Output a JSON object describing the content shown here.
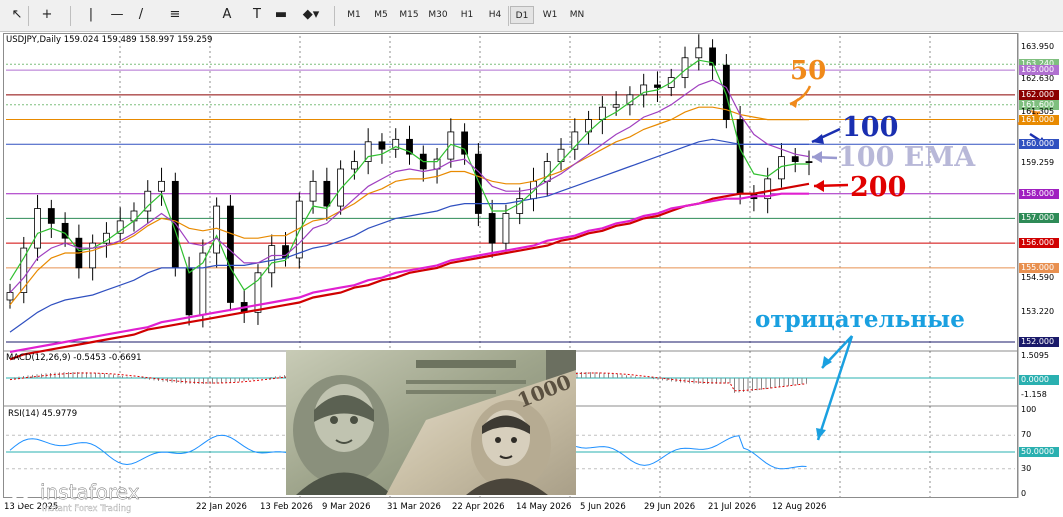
{
  "toolbar": {
    "tools": [
      "cursor-icon",
      "crosshair-icon",
      "vertical-line-icon",
      "horizontal-line-icon",
      "trendline-icon",
      "fibonacci-icon",
      "text-icon",
      "text-label-icon",
      "rectangle-icon",
      "shapes-menu-icon"
    ],
    "text_tool": "A",
    "timeframes": [
      "M1",
      "M5",
      "M15",
      "M30",
      "H1",
      "H4",
      "D1",
      "W1",
      "MN"
    ]
  },
  "chart_title": "USDJPY,Daily  159.024 159.489 158.997 159.259",
  "macd_title": "MACD(12,26,9) -0.5453 -0.6691",
  "rsi_title": "RSI(14) 45.9779",
  "annotations": {
    "ema50": "50",
    "ema100": "100",
    "ema100_label": "100 EMA",
    "ema200": "200",
    "negative": "отрицательные"
  },
  "price_labels": [
    {
      "value": "163.950",
      "bg": "none"
    },
    {
      "value": "163.240",
      "bg": "#7fbf7f"
    },
    {
      "value": "163.000",
      "bg": "#b070d0"
    },
    {
      "value": "162.630",
      "bg": "none"
    },
    {
      "value": "162.000",
      "bg": "#8b0000"
    },
    {
      "value": "161.600",
      "bg": "#7fbf7f"
    },
    {
      "value": "161.305",
      "bg": "none"
    },
    {
      "value": "161.000",
      "bg": "#e88a00"
    },
    {
      "value": "160.000",
      "bg": "#3050c0"
    },
    {
      "value": "159.259",
      "bg": "none"
    },
    {
      "value": "158.000",
      "bg": "#a020c0"
    },
    {
      "value": "157.000",
      "bg": "#2e8b57"
    },
    {
      "value": "156.000",
      "bg": "#d00000"
    },
    {
      "value": "155.000",
      "bg": "#e89050"
    },
    {
      "value": "154.590",
      "bg": "none"
    },
    {
      "value": "153.220",
      "bg": "none"
    },
    {
      "value": "152.000",
      "bg": "#1a1a6a"
    }
  ],
  "macd_labels": [
    {
      "value": "1.5095",
      "bg": "none"
    },
    {
      "value": "0.0000",
      "bg": "#2ab0b0"
    },
    {
      "value": "-1.158",
      "bg": "none"
    }
  ],
  "rsi_labels": [
    {
      "value": "100",
      "bg": "none"
    },
    {
      "value": "70",
      "bg": "none"
    },
    {
      "value": "50.0000",
      "bg": "#2ab0b0"
    },
    {
      "value": "30",
      "bg": "none"
    },
    {
      "value": "0",
      "bg": "none"
    }
  ],
  "logo": {
    "brand": "instaforex",
    "tagline": "Instant Forex Trading"
  },
  "photo": {
    "note_left": "dollar-banknote",
    "note_right": "yen-banknote",
    "yen_value": "1000"
  },
  "chart_data": {
    "type": "line",
    "title": "USDJPY,Daily",
    "ohlc_last": {
      "open": 159.024,
      "high": 159.489,
      "low": 158.997,
      "close": 159.259
    },
    "x_ticks": [
      "13 Dec 2025",
      "22 Jan 2026",
      "13 Feb 2026",
      "9 Mar 2026",
      "31 Mar 2026",
      "22 Apr 2026",
      "14 May 2026",
      "5 Jun 2026",
      "29 Jun 2026",
      "21 Jul 2026",
      "12 Aug 2026"
    ],
    "ylim": [
      152.0,
      164.3
    ],
    "y_ticks": [
      163.95,
      162.63,
      161.305,
      159.259,
      154.59,
      153.22
    ],
    "close_series": [
      154.0,
      155.8,
      157.4,
      156.8,
      156.2,
      155.0,
      156.0,
      156.4,
      156.9,
      157.3,
      158.1,
      158.5,
      155.0,
      153.1,
      155.6,
      157.5,
      153.6,
      153.2,
      154.8,
      155.9,
      155.4,
      157.7,
      158.5,
      157.5,
      159.0,
      159.3,
      160.1,
      159.8,
      160.2,
      159.6,
      159.0,
      159.4,
      160.5,
      159.6,
      157.2,
      156.0,
      157.2,
      157.8,
      158.5,
      159.3,
      159.8,
      160.5,
      161.0,
      161.5,
      161.6,
      162.0,
      162.4,
      162.3,
      162.7,
      163.5,
      163.9,
      163.2,
      161.0,
      158.0,
      157.8,
      158.6,
      159.5,
      159.3,
      159.26
    ],
    "series": [
      {
        "name": "EMA 50",
        "color": "#e88a00",
        "values": [
          153.5,
          154.2,
          154.9,
          155.4,
          155.6,
          155.6,
          155.7,
          155.9,
          156.0,
          156.3,
          156.7,
          157.0,
          156.9,
          156.6,
          156.5,
          156.6,
          156.4,
          156.2,
          156.2,
          156.3,
          156.3,
          156.6,
          156.9,
          157.0,
          157.3,
          157.6,
          158.0,
          158.2,
          158.5,
          158.6,
          158.6,
          158.7,
          158.9,
          158.9,
          158.7,
          158.5,
          158.4,
          158.4,
          158.5,
          158.7,
          158.9,
          159.2,
          159.5,
          159.8,
          160.1,
          160.3,
          160.6,
          160.8,
          161.0,
          161.3,
          161.5,
          161.5,
          161.4,
          161.2,
          161.1,
          161.0,
          161.0,
          161.0,
          161.0
        ]
      },
      {
        "name": "EMA 100",
        "color": "#3050c0",
        "values": [
          152.4,
          152.8,
          153.2,
          153.5,
          153.7,
          153.8,
          153.9,
          154.1,
          154.3,
          154.5,
          154.8,
          155.0,
          155.0,
          155.0,
          155.0,
          155.1,
          155.1,
          155.1,
          155.2,
          155.3,
          155.4,
          155.6,
          155.8,
          155.9,
          156.1,
          156.3,
          156.6,
          156.8,
          157.0,
          157.1,
          157.2,
          157.3,
          157.5,
          157.6,
          157.6,
          157.6,
          157.6,
          157.7,
          157.8,
          157.9,
          158.1,
          158.3,
          158.5,
          158.7,
          158.9,
          159.1,
          159.3,
          159.5,
          159.7,
          159.9,
          160.1,
          160.2,
          160.1,
          160.0,
          160.0,
          160.0,
          160.0,
          160.0,
          160.0
        ]
      },
      {
        "name": "EMA 200",
        "color": "#d00000",
        "values": [
          151.3,
          151.5,
          151.6,
          151.7,
          151.8,
          151.9,
          152.0,
          152.1,
          152.2,
          152.3,
          152.5,
          152.6,
          152.7,
          152.8,
          152.9,
          153.0,
          153.1,
          153.2,
          153.3,
          153.4,
          153.5,
          153.6,
          153.8,
          153.9,
          154.0,
          154.2,
          154.3,
          154.5,
          154.6,
          154.8,
          154.9,
          155.0,
          155.2,
          155.3,
          155.4,
          155.5,
          155.6,
          155.7,
          155.8,
          155.9,
          156.1,
          156.2,
          156.4,
          156.5,
          156.7,
          156.8,
          157.0,
          157.1,
          157.3,
          157.5,
          157.6,
          157.8,
          157.9,
          158.0,
          158.0,
          158.1,
          158.2,
          158.3,
          158.4
        ]
      },
      {
        "name": "MA magenta",
        "color": "#e020d0",
        "values": [
          151.6,
          151.7,
          151.8,
          151.9,
          152.0,
          152.1,
          152.2,
          152.3,
          152.4,
          152.5,
          152.6,
          152.8,
          152.9,
          153.0,
          153.1,
          153.2,
          153.3,
          153.4,
          153.5,
          153.6,
          153.7,
          153.8,
          154.0,
          154.1,
          154.2,
          154.3,
          154.5,
          154.6,
          154.8,
          154.9,
          155.0,
          155.1,
          155.3,
          155.4,
          155.5,
          155.6,
          155.7,
          155.8,
          155.9,
          156.1,
          156.2,
          156.3,
          156.5,
          156.6,
          156.8,
          156.9,
          157.1,
          157.2,
          157.4,
          157.5,
          157.6,
          157.7,
          157.8,
          157.8,
          157.9,
          157.9,
          158.0,
          158.0,
          158.0
        ]
      },
      {
        "name": "EMA fast green",
        "color": "#30c030",
        "values": [
          154.5,
          155.4,
          156.4,
          156.6,
          156.4,
          155.7,
          155.8,
          156.1,
          156.5,
          156.9,
          157.5,
          158.0,
          156.5,
          154.8,
          155.2,
          156.3,
          155.0,
          154.1,
          154.5,
          155.2,
          155.3,
          156.5,
          157.5,
          157.4,
          158.2,
          158.8,
          159.5,
          159.6,
          159.9,
          159.7,
          159.3,
          159.3,
          160.0,
          159.8,
          158.5,
          157.3,
          157.3,
          157.6,
          158.1,
          158.7,
          159.3,
          159.9,
          160.5,
          161.0,
          161.3,
          161.7,
          162.1,
          162.2,
          162.5,
          163.0,
          163.4,
          163.3,
          162.0,
          159.8,
          158.8,
          158.7,
          159.1,
          159.2,
          159.2
        ]
      },
      {
        "name": "EMA slow violet",
        "color": "#a040c0",
        "values": [
          154.0,
          154.6,
          155.4,
          155.8,
          156.0,
          155.8,
          155.8,
          155.9,
          156.1,
          156.4,
          156.8,
          157.2,
          156.8,
          156.0,
          155.9,
          156.2,
          155.7,
          155.2,
          155.2,
          155.5,
          155.5,
          156.0,
          156.6,
          156.8,
          157.3,
          157.8,
          158.3,
          158.6,
          158.9,
          159.0,
          158.9,
          159.0,
          159.3,
          159.4,
          158.9,
          158.3,
          158.1,
          158.1,
          158.2,
          158.5,
          158.8,
          159.2,
          159.6,
          160.0,
          160.4,
          160.7,
          161.1,
          161.3,
          161.6,
          162.0,
          162.4,
          162.6,
          162.3,
          161.2,
          160.4,
          160.0,
          159.8,
          159.6,
          159.5
        ]
      }
    ],
    "macd": {
      "line": -0.5453,
      "signal": -0.6691,
      "ylim": [
        -1.158,
        1.5095
      ]
    },
    "rsi": {
      "value": 45.9779,
      "levels": [
        70,
        50,
        30
      ],
      "ylim": [
        0,
        100
      ]
    },
    "horizontal_levels": [
      {
        "y": 163.24,
        "color": "#7fbf7f"
      },
      {
        "y": 163.0,
        "color": "#b070d0"
      },
      {
        "y": 162.0,
        "color": "#8b0000"
      },
      {
        "y": 161.6,
        "color": "#7fbf7f"
      },
      {
        "y": 161.0,
        "color": "#e88a00"
      },
      {
        "y": 160.0,
        "color": "#3050c0"
      },
      {
        "y": 158.0,
        "color": "#a020c0"
      },
      {
        "y": 157.0,
        "color": "#2e8b57"
      },
      {
        "y": 156.0,
        "color": "#d00000"
      },
      {
        "y": 155.0,
        "color": "#e89050"
      },
      {
        "y": 152.0,
        "color": "#1a1a6a"
      }
    ],
    "grid": true
  }
}
